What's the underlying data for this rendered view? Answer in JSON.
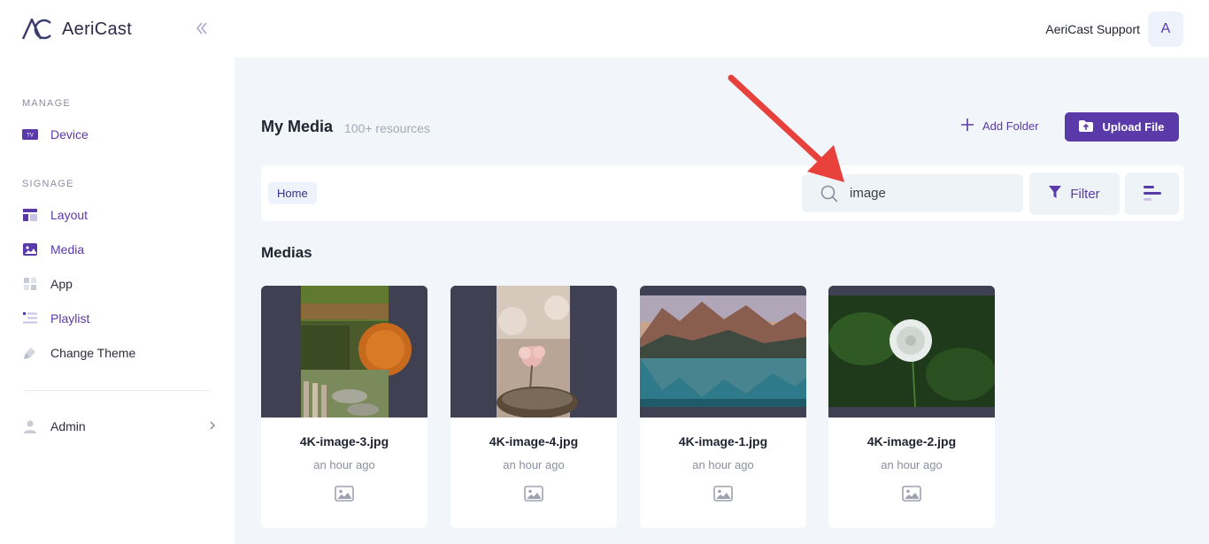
{
  "app": {
    "name": "AeriCast"
  },
  "sidebar": {
    "sections": [
      {
        "title": "MANAGE"
      },
      {
        "title": "SIGNAGE"
      }
    ],
    "items": [
      {
        "label": "Device",
        "icon": "tv-icon"
      },
      {
        "label": "Layout",
        "icon": "layout-icon"
      },
      {
        "label": "Media",
        "icon": "image-icon"
      },
      {
        "label": "App",
        "icon": "apps-grid-icon"
      },
      {
        "label": "Playlist",
        "icon": "playlist-icon"
      },
      {
        "label": "Change Theme",
        "icon": "paint-brush-icon"
      }
    ],
    "admin": {
      "label": "Admin",
      "icon": "user-icon"
    },
    "device_badge": "TV"
  },
  "topbar": {
    "user_name": "AeriCast Support",
    "avatar_initial": "A"
  },
  "page": {
    "title": "My Media",
    "count": "100+ resources",
    "add_folder_label": "Add Folder",
    "upload_label": "Upload File"
  },
  "toolbar": {
    "breadcrumb": "Home",
    "search_value": "image",
    "filter_label": "Filter"
  },
  "section_heading": "Medias",
  "media": [
    {
      "name": "4K-image-3.jpg",
      "time": "an hour ago"
    },
    {
      "name": "4K-image-4.jpg",
      "time": "an hour ago"
    },
    {
      "name": "4K-image-1.jpg",
      "time": "an hour ago"
    },
    {
      "name": "4K-image-2.jpg",
      "time": "an hour ago"
    }
  ],
  "colors": {
    "accent": "#5a3aa8",
    "annotation_arrow": "#e8413c",
    "thumb_background": "#3f4152"
  }
}
